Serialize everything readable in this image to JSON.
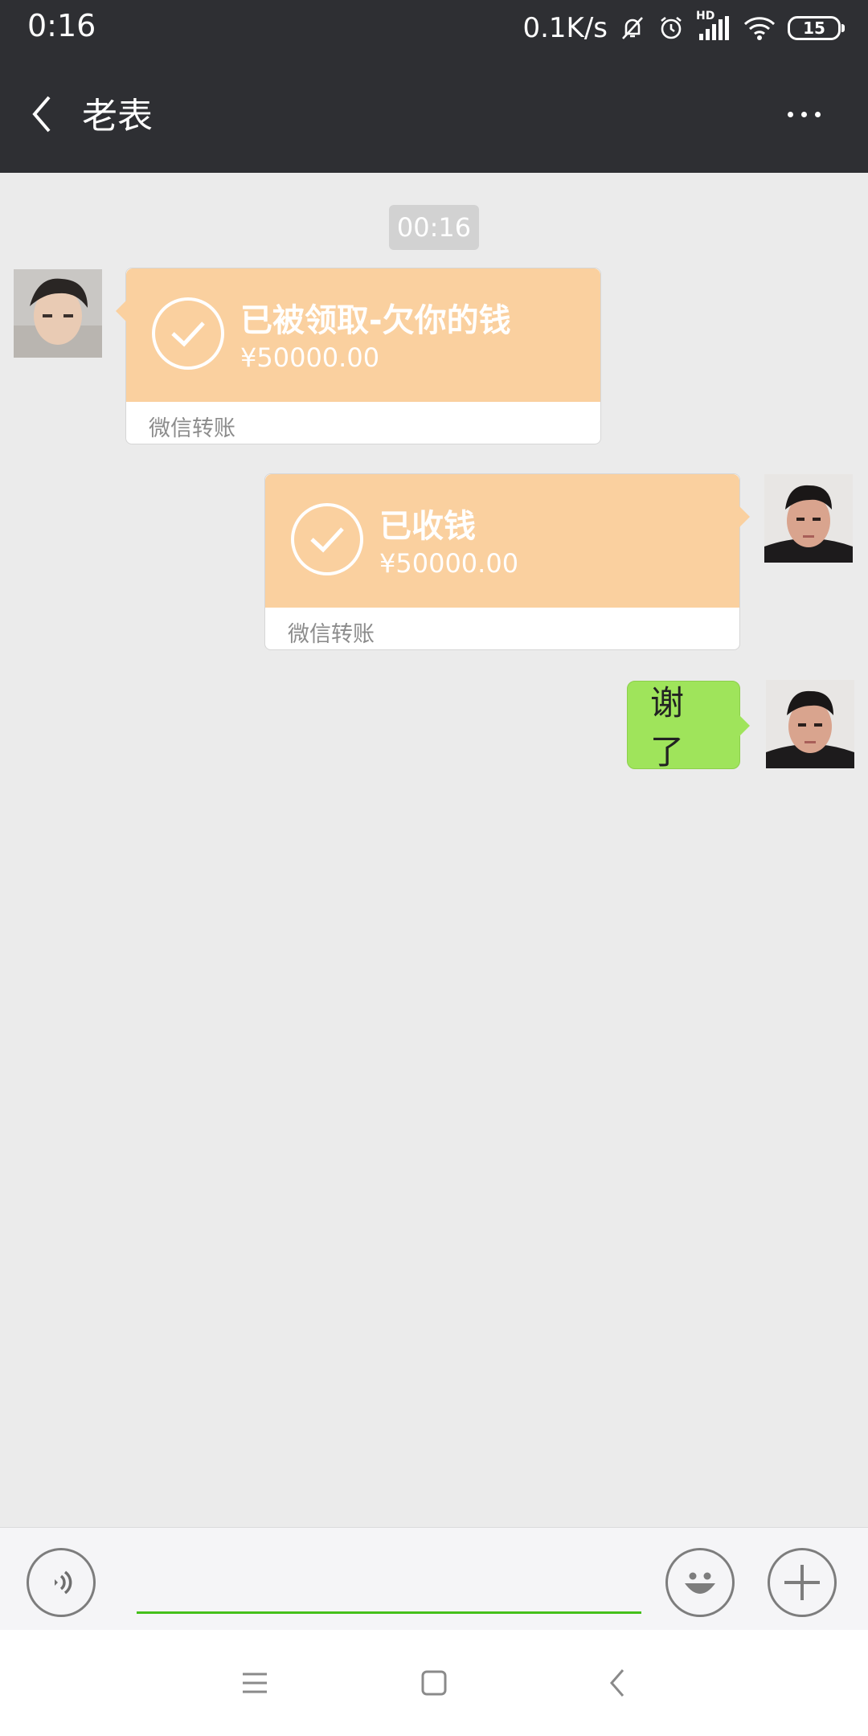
{
  "status_bar": {
    "time": "0:16",
    "net_speed": "0.1K/s",
    "network_badge": "HD",
    "battery": "15",
    "icons": [
      "mute-bell-icon",
      "alarm-icon",
      "signal-icon",
      "wifi-icon",
      "battery-icon"
    ]
  },
  "header": {
    "back_icon": "chevron-left-icon",
    "title": "老表",
    "more_icon": "more-dots-icon"
  },
  "chat": {
    "timestamp": "00:16",
    "messages": [
      {
        "side": "left",
        "type": "transfer",
        "title": "已被领取-欠你的钱",
        "amount": "¥50000.00",
        "footer": "微信转账"
      },
      {
        "side": "right",
        "type": "transfer",
        "title": "已收钱",
        "amount": "¥50000.00",
        "footer": "微信转账"
      },
      {
        "side": "right",
        "type": "text",
        "text": "谢了"
      }
    ]
  },
  "input_bar": {
    "voice_icon": "voice-icon",
    "message_value": "",
    "emoji_icon": "emoji-icon",
    "plus_icon": "plus-icon"
  },
  "nav_bar": {
    "icons": [
      "menu-icon",
      "home-icon",
      "back-icon"
    ]
  },
  "colors": {
    "header_bg": "#2e2f33",
    "chat_bg": "#ebebeb",
    "transfer_bg": "#fad09f",
    "sent_bubble": "#9fe45b",
    "input_underline": "#45c01a"
  }
}
